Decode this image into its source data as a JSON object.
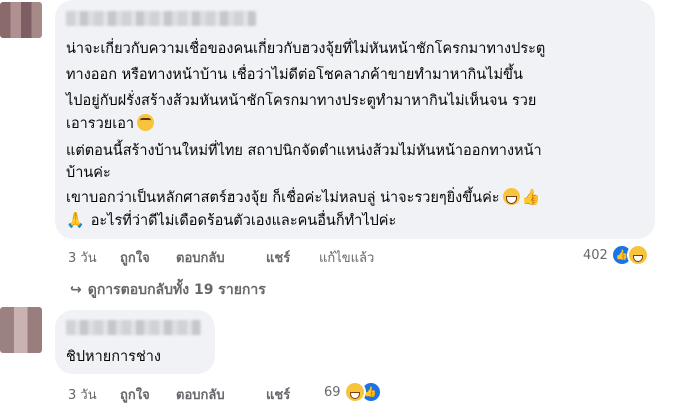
{
  "comments": [
    {
      "author": "",
      "text_lines": [
        "น่าจะเกี่ยวกับความเชื่อของคนเกี่ยวกับฮวงจุ้ยที่ไม่หันหน้าชักโครกมาทางประตู",
        "ทางออก หรือทางหน้าบ้าน เชื่อว่าไม่ดีต่อโชคลาภค้าขายทำมาหากินไม่ขึ้น",
        "ไปอยู่กับฝรั่งสร้างส้วมหันหน้าชักโครกมาทางประตูทำมาหากินไม่เห็นจน รวย",
        "เอารวยเอา",
        "แต่ตอนนี้สร้างบ้านใหม่ที่ไทย สถาปนิกจัดตำแหน่งส้วมไม่หันหน้าออกทางหน้า",
        "บ้านค่ะ",
        "เขาบอกว่าเป็นหลักศาสตร์ฮวงจุ้ย ก็เชื่อค่ะไม่หลบลู่ น่าจะรวยๆยิ่งขึ้นค่ะ",
        "อะไรที่ว่าดีไม่เดือดร้อนตัวเองและคนอื่นก็ทำไปค่ะ"
      ],
      "emoji_names": [
        "grinning-squint-emoji",
        "grin-emoji",
        "thumbs-up-icon",
        "folded-hands-icon"
      ],
      "time": "3 วัน",
      "like_label": "ถูกใจ",
      "reply_label": "ตอบกลับ",
      "share_label": "แชร์",
      "edited_label": "แก้ไขแล้ว",
      "reaction_count": "402",
      "view_replies": "ดูการตอบกลับทั้ง 19 รายการ"
    },
    {
      "author": "",
      "text": "ชิปหายการช่าง",
      "time": "3 วัน",
      "like_label": "ถูกใจ",
      "reply_label": "ตอบกลับ",
      "share_label": "แชร์",
      "reaction_count": "69"
    }
  ],
  "colors": {
    "bubble": "#f0f2f5",
    "meta_text": "#65676b",
    "like_blue": "#1b74e4",
    "haha_yellow": "#f7c43b"
  }
}
